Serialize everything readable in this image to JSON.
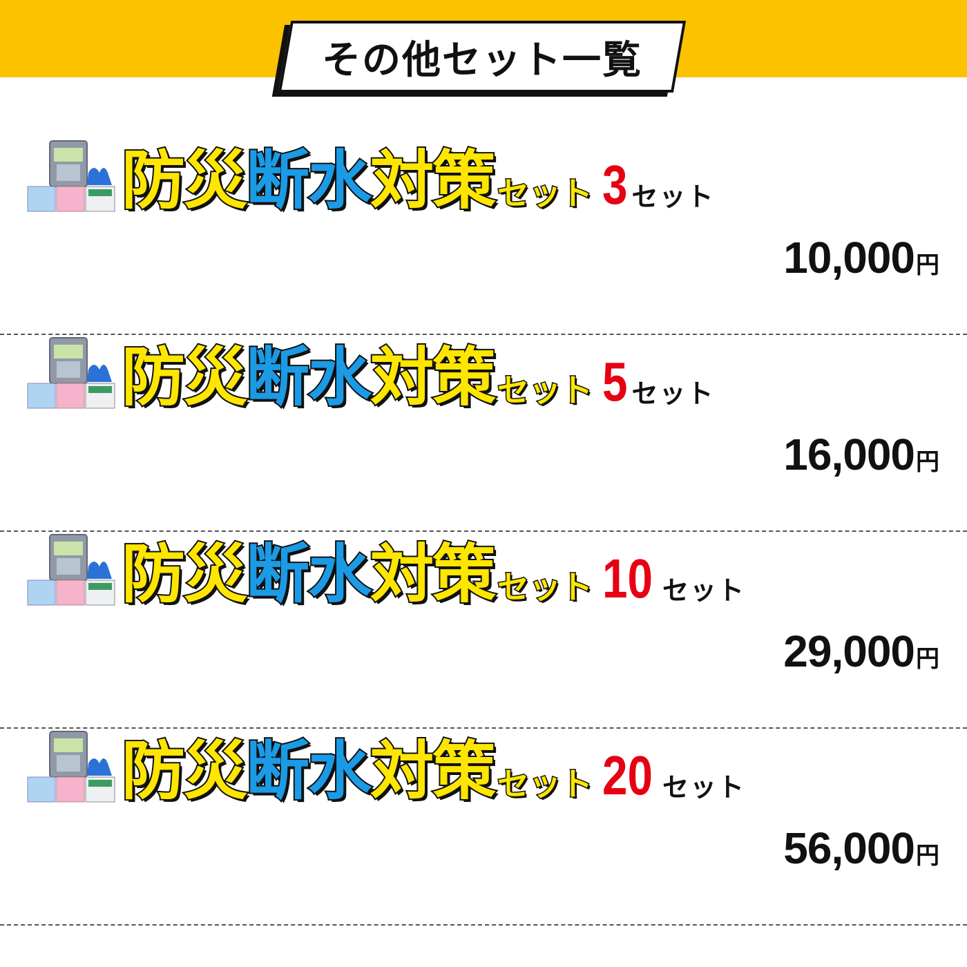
{
  "header": {
    "title": "その他セット一覧",
    "band_color": "#fcc200"
  },
  "rows": [
    {
      "name_parts": [
        "防災",
        "断水",
        "対策"
      ],
      "set_label": "セット",
      "quantity": "3",
      "quantity_unit": "セット",
      "price": "10,000",
      "currency": "円"
    },
    {
      "name_parts": [
        "防災",
        "断水",
        "対策"
      ],
      "set_label": "セット",
      "quantity": "5",
      "quantity_unit": "セット",
      "price": "16,000",
      "currency": "円"
    },
    {
      "name_parts": [
        "防災",
        "断水",
        "対策"
      ],
      "set_label": "セット",
      "quantity": "10",
      "quantity_unit": "セット",
      "price": "29,000",
      "currency": "円"
    },
    {
      "name_parts": [
        "防災",
        "断水",
        "対策"
      ],
      "set_label": "セット",
      "quantity": "20",
      "quantity_unit": "セット",
      "price": "56,000",
      "currency": "円"
    }
  ],
  "colors": {
    "title_yellow": "#ffe600",
    "title_blue": "#1b9be6",
    "quantity_red": "#e60012"
  },
  "icons": {
    "product": "product-set-icon"
  }
}
